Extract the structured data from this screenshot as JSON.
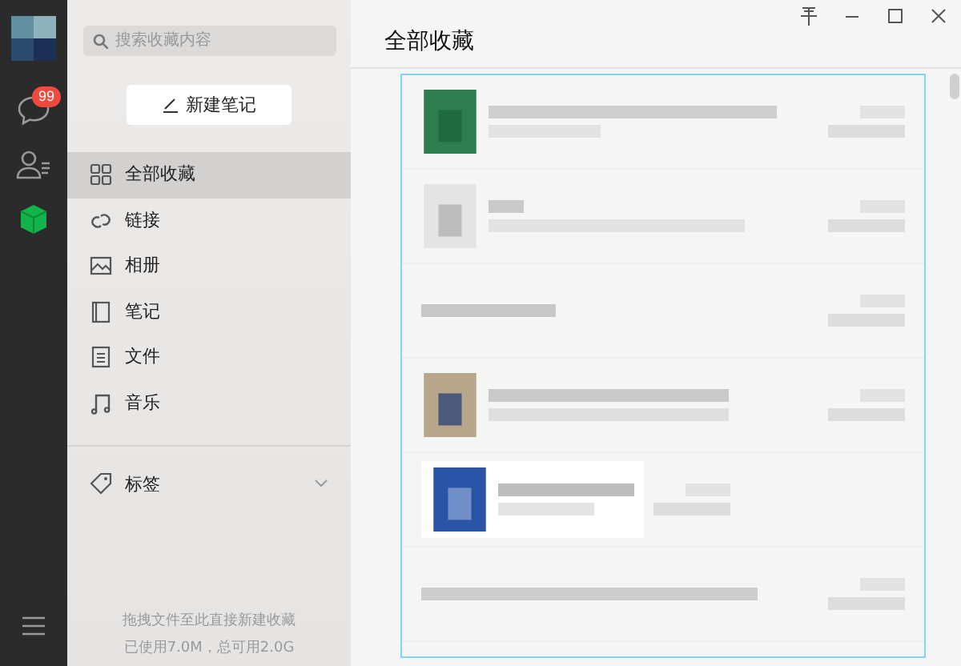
{
  "rail": {
    "items": [
      {
        "kind": "chat",
        "badge": "99",
        "selected": false
      },
      {
        "kind": "contacts",
        "selected": false
      },
      {
        "kind": "favorites",
        "selected": true
      }
    ]
  },
  "sidebar": {
    "search": {
      "placeholder": "搜索收藏内容"
    },
    "new_note_button": "新建笔记",
    "items": [
      {
        "kind": "all",
        "label": "全部收藏",
        "selected": true
      },
      {
        "kind": "link",
        "label": "链接",
        "selected": false
      },
      {
        "kind": "album",
        "label": "相册",
        "selected": false
      },
      {
        "kind": "note",
        "label": "笔记",
        "selected": false
      },
      {
        "kind": "file",
        "label": "文件",
        "selected": false
      },
      {
        "kind": "music",
        "label": "音乐",
        "selected": false
      }
    ],
    "tags": {
      "label": "标签",
      "expanded": false
    },
    "footer": [
      "拖拽文件至此直接新建收藏",
      "已使用7.0M，总可用2.0G"
    ]
  },
  "main": {
    "title": "全部收藏"
  }
}
